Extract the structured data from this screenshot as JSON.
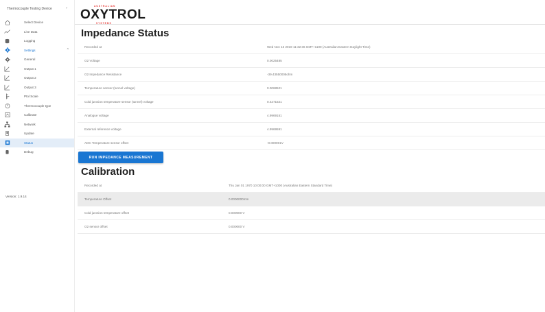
{
  "sidebar": {
    "device_label": "Thermocouple Testing Device",
    "items": [
      {
        "label": "Select Device",
        "icon": "home-icon"
      },
      {
        "label": "Live Data",
        "icon": "trend-line-icon"
      },
      {
        "label": "Logging",
        "icon": "database-icon"
      },
      {
        "label": "Settings",
        "icon": "gear-icon"
      },
      {
        "label": "General",
        "icon": "gear-icon"
      },
      {
        "label": "Output 1",
        "icon": "chart-line-icon"
      },
      {
        "label": "Output 2",
        "icon": "chart-line-icon"
      },
      {
        "label": "Output 3",
        "icon": "chart-line-icon"
      },
      {
        "label": "Ptol Scale",
        "icon": "ruler-icon"
      },
      {
        "label": "Thermocouple type",
        "icon": "thermometer-icon"
      },
      {
        "label": "Calibrate",
        "icon": "calibrate-icon"
      },
      {
        "label": "Network",
        "icon": "network-icon"
      },
      {
        "label": "Update",
        "icon": "device-icon"
      },
      {
        "label": "Status",
        "icon": "status-icon"
      },
      {
        "label": "Debug",
        "icon": "bug-icon"
      }
    ],
    "version": "Version: 1.9.14"
  },
  "logo": {
    "tagline_top": "AUSTRALIAN",
    "word": "OXYTROL",
    "tagline_bottom": "SYSTEMS"
  },
  "impedance": {
    "title": "Impedance Status",
    "rows": [
      {
        "label": "Recorded at",
        "value": "Wed Nov 13 2019 11:32:36 GMT+1100 (Australian Eastern Daylight Time)"
      },
      {
        "label": "O2 Voltage",
        "value": "0.0025485"
      },
      {
        "label": "O2 Impedance Resistance",
        "value": "-39.43550005ohm"
      },
      {
        "label": "Temperature sensor (tunnel voltage)",
        "value": "0.0068521"
      },
      {
        "label": "Cold junction temperature sensor (tunnel) voltage",
        "value": "0.4271521"
      },
      {
        "label": "Analogue voltage",
        "value": "4.9969151"
      },
      {
        "label": "External reference voltage",
        "value": "4.9969591"
      },
      {
        "label": "ADC Temperature sensor offset",
        "value": "-0.000001V"
      }
    ],
    "button_label": "RUN IMPEDANCE MEASUREMENT"
  },
  "calibration": {
    "title": "Calibration",
    "rows": [
      {
        "label": "Recorded at",
        "value": "Thu Jan 01 1970 10:00:00 GMT+1000 (Australian Eastern Standard Time)"
      },
      {
        "label": "Temperature Offset",
        "value": "0.0000000mm"
      },
      {
        "label": "Cold junction temperature offset",
        "value": "0.000000 V"
      },
      {
        "label": "O2 sensor offset",
        "value": "0.000000 V"
      }
    ]
  },
  "colors": {
    "accent": "#1976d2",
    "brand_red": "#e53935",
    "selected_bg": "#e3edf8",
    "shaded_row": "#ebebeb"
  }
}
